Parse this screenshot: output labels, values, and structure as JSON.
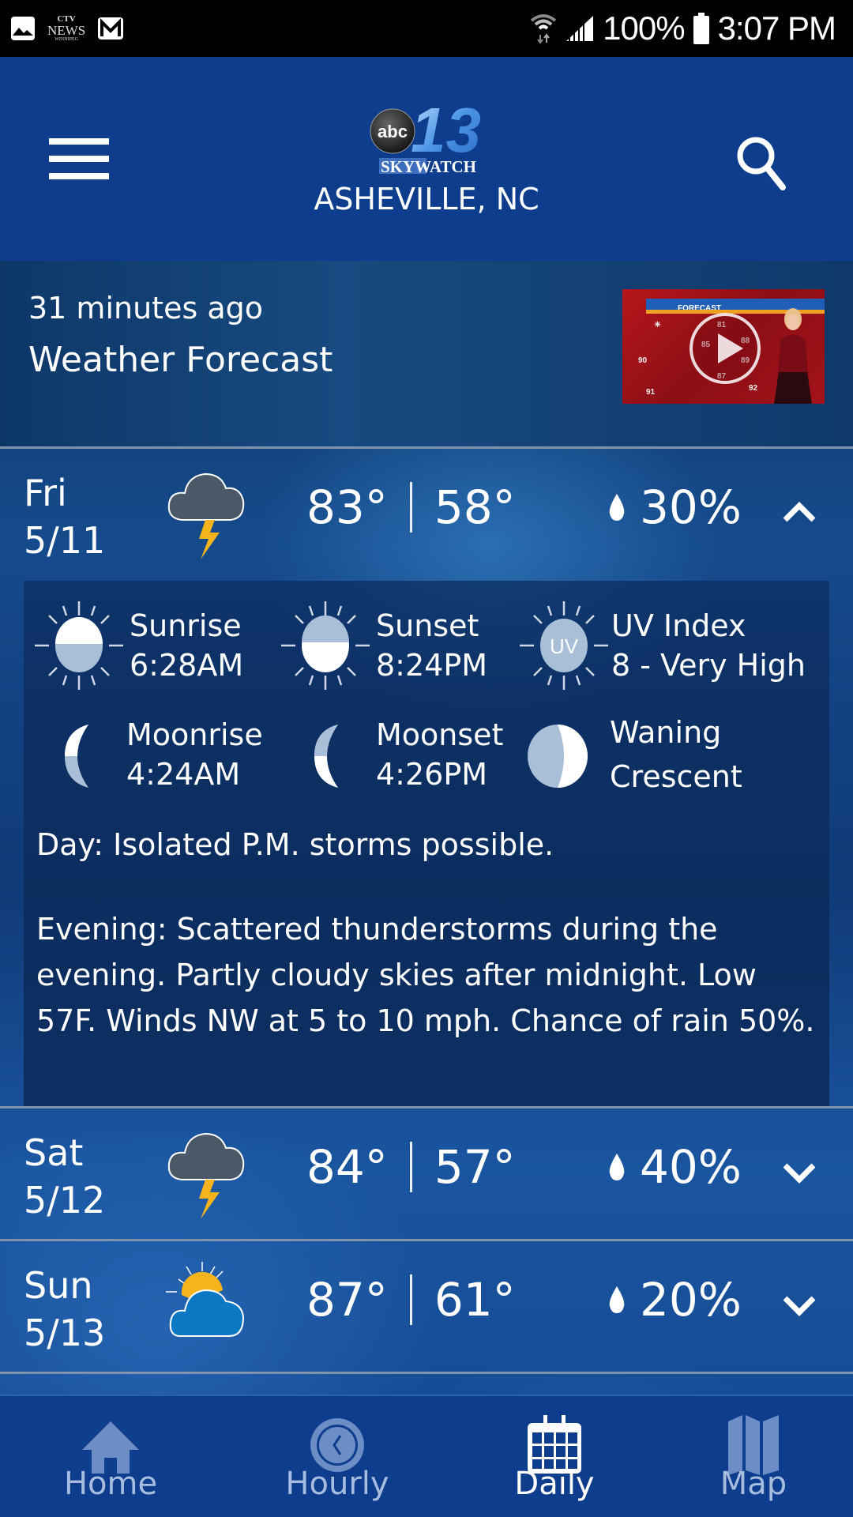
{
  "status_bar": {
    "notification_icons": [
      "gallery-icon",
      "ctv-news-icon",
      "gmail-icon"
    ],
    "ctv": {
      "line1": "CTV",
      "line2": "NEWS",
      "line3": "WINNIPEG"
    },
    "battery": "100%",
    "time": "3:07 PM"
  },
  "header": {
    "logo": {
      "network": "abc",
      "channel": "13",
      "brand": "SKYWATCH"
    },
    "location": "ASHEVILLE, NC"
  },
  "video": {
    "time_ago": "31 minutes ago",
    "title": "Weather Forecast",
    "thumb_banner": "FORECAST"
  },
  "days": [
    {
      "day": "Fri",
      "date": "5/11",
      "condition": "thunderstorm",
      "high": "83°",
      "low": "58°",
      "precip": "30%",
      "expanded": true
    },
    {
      "day": "Sat",
      "date": "5/12",
      "condition": "thunderstorm",
      "high": "84°",
      "low": "57°",
      "precip": "40%",
      "expanded": false
    },
    {
      "day": "Sun",
      "date": "5/13",
      "condition": "partly-cloudy",
      "high": "87°",
      "low": "61°",
      "precip": "20%",
      "expanded": false
    }
  ],
  "detail": {
    "sunrise": {
      "label": "Sunrise",
      "value": "6:28AM"
    },
    "sunset": {
      "label": "Sunset",
      "value": "8:24PM"
    },
    "uv": {
      "label": "UV Index",
      "value": "8 - Very High",
      "icon_text": "UV"
    },
    "moonrise": {
      "label": "Moonrise",
      "value": "4:24AM"
    },
    "moonset": {
      "label": "Moonset",
      "value": "4:26PM"
    },
    "moon_phase": {
      "line1": "Waning",
      "line2": "Crescent"
    },
    "day_text": "Day: Isolated P.M. storms possible.",
    "evening_text": "Evening: Scattered thunderstorms during the evening. Partly cloudy skies after midnight. Low 57F. Winds NW at 5 to 10 mph. Chance of rain 50%."
  },
  "nav": [
    {
      "label": "Home",
      "icon": "home-icon",
      "active": false
    },
    {
      "label": "Hourly",
      "icon": "clock-icon",
      "active": false
    },
    {
      "label": "Daily",
      "icon": "calendar-icon",
      "active": true
    },
    {
      "label": "Map",
      "icon": "map-icon",
      "active": false
    }
  ],
  "colors": {
    "header_bg": "#0d3d8c",
    "lightning": "#f5b41c",
    "cloud": "#4a5868",
    "inactive_nav": "#a7bde0"
  }
}
